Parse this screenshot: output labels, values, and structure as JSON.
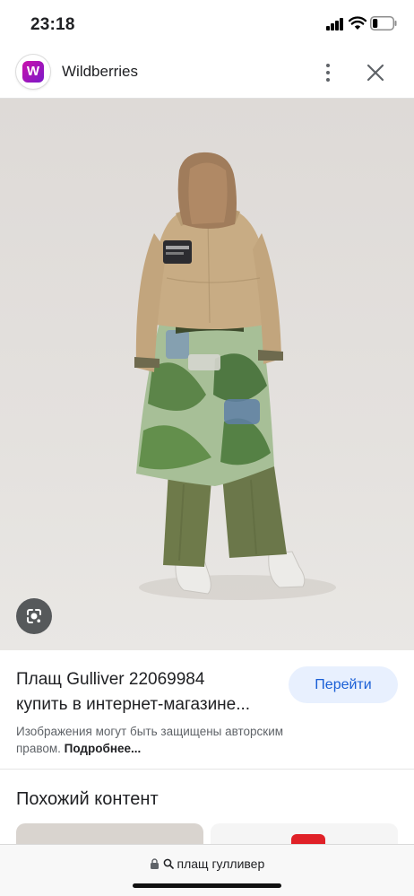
{
  "status_bar": {
    "time": "23:18",
    "battery_level": 0.25
  },
  "header": {
    "site_name": "Wildberries",
    "logo_letter": "W",
    "logo_color": "#a21bc2"
  },
  "result": {
    "title_line1": "Плащ Gulliver 22069984",
    "title_line2": "купить в интернет-магазине...",
    "go_button": "Перейти",
    "copyright_text": "Изображения могут быть защищены авторским правом.",
    "copyright_more": "Подробнее..."
  },
  "similar": {
    "heading": "Похожий контент"
  },
  "url_bar": {
    "query": "плащ гулливер"
  },
  "colors": {
    "accent": "#1a5fd6",
    "button_bg": "#e8f0fe",
    "brand": "#cb11ab"
  }
}
